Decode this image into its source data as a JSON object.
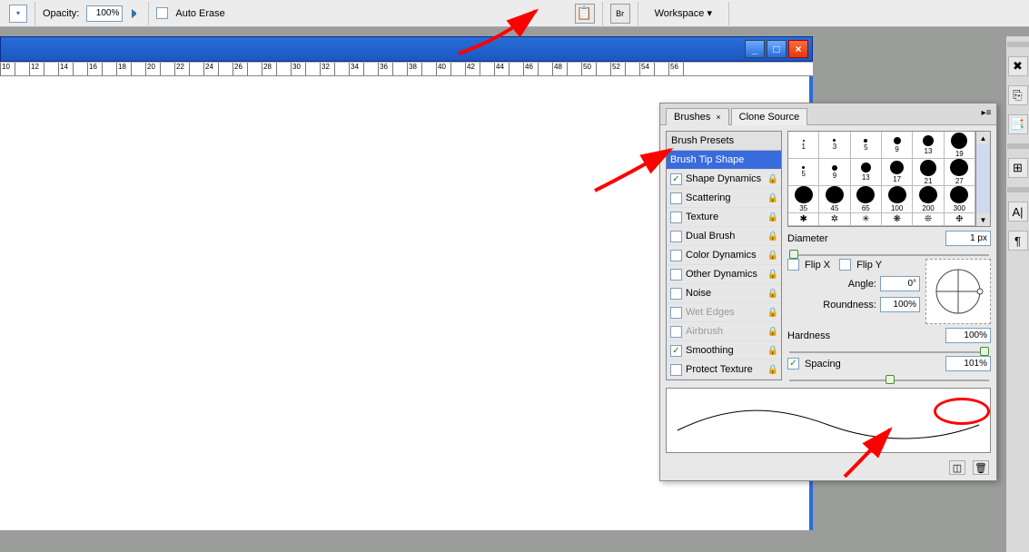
{
  "toolbar": {
    "opacity_label": "Opacity:",
    "opacity_value": "100%",
    "auto_erase_label": "Auto Erase",
    "workspace_label": "Workspace ▾",
    "bridge_label": "Br"
  },
  "ruler_ticks": [
    "10",
    "12",
    "14",
    "16",
    "18",
    "20",
    "22",
    "24",
    "26",
    "28",
    "30",
    "32",
    "34",
    "36",
    "38",
    "40",
    "42",
    "44",
    "46",
    "48",
    "50",
    "52",
    "54",
    "56"
  ],
  "panel": {
    "tabs": [
      {
        "label": "Brushes",
        "active": true
      },
      {
        "label": "Clone Source",
        "active": false
      }
    ],
    "list_header": "Brush Presets",
    "list": [
      {
        "label": "Brush Tip Shape",
        "selected": true,
        "lock": false,
        "checkbox": false
      },
      {
        "label": "Shape Dynamics",
        "checked": true,
        "lock": true,
        "checkbox": true
      },
      {
        "label": "Scattering",
        "checked": false,
        "lock": true,
        "checkbox": true
      },
      {
        "label": "Texture",
        "checked": false,
        "lock": true,
        "checkbox": true
      },
      {
        "label": "Dual Brush",
        "checked": false,
        "lock": true,
        "checkbox": true
      },
      {
        "label": "Color Dynamics",
        "checked": false,
        "lock": true,
        "checkbox": true
      },
      {
        "label": "Other Dynamics",
        "checked": false,
        "lock": true,
        "checkbox": true
      },
      {
        "label": "Noise",
        "checked": false,
        "lock": true,
        "checkbox": true
      },
      {
        "label": "Wet Edges",
        "disabled": true,
        "lock": true,
        "checkbox": true
      },
      {
        "label": "Airbrush",
        "disabled": true,
        "lock": true,
        "checkbox": true
      },
      {
        "label": "Smoothing",
        "checked": true,
        "lock": true,
        "checkbox": true
      },
      {
        "label": "Protect Texture",
        "checked": false,
        "lock": true,
        "checkbox": true
      }
    ],
    "presets": [
      {
        "size": 1,
        "d": 2
      },
      {
        "size": 3,
        "d": 3
      },
      {
        "size": 5,
        "d": 4
      },
      {
        "size": 9,
        "d": 8
      },
      {
        "size": 13,
        "d": 12
      },
      {
        "size": 19,
        "d": 18
      },
      {
        "size": 5,
        "d": 3
      },
      {
        "size": 9,
        "d": 6
      },
      {
        "size": 13,
        "d": 11
      },
      {
        "size": 17,
        "d": 15
      },
      {
        "size": 21,
        "d": 18
      },
      {
        "size": 27,
        "d": 20
      },
      {
        "size": 35,
        "d": 20
      },
      {
        "size": 45,
        "d": 20
      },
      {
        "size": 65,
        "d": 20
      },
      {
        "size": 100,
        "d": 20
      },
      {
        "size": 200,
        "d": 20
      },
      {
        "size": 300,
        "d": 20
      }
    ],
    "diameter_label": "Diameter",
    "diameter_value": "1 px",
    "flipx_label": "Flip X",
    "flipy_label": "Flip Y",
    "angle_label": "Angle:",
    "angle_value": "0°",
    "roundness_label": "Roundness:",
    "roundness_value": "100%",
    "hardness_label": "Hardness",
    "hardness_value": "100%",
    "spacing_label": "Spacing",
    "spacing_value": "101%"
  },
  "palette_icons": [
    "⚙",
    "⎘",
    "⎙",
    "≣",
    "⌗",
    "A|",
    "¶"
  ]
}
